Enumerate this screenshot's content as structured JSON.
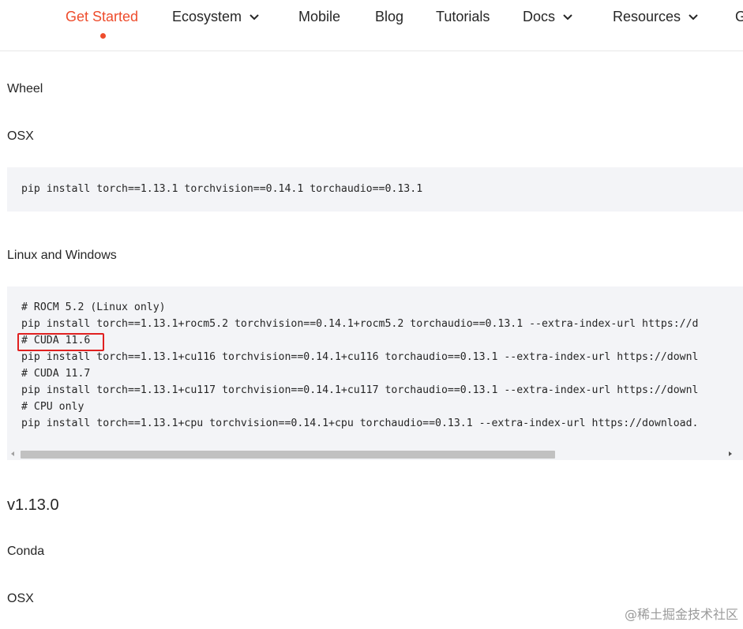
{
  "nav": {
    "items": [
      {
        "label": "Get Started",
        "active": true,
        "dropdown": false
      },
      {
        "label": "Ecosystem",
        "dropdown": true
      },
      {
        "label": "Mobile",
        "dropdown": false
      },
      {
        "label": "Blog",
        "dropdown": false
      },
      {
        "label": "Tutorials",
        "dropdown": false
      },
      {
        "label": "Docs",
        "dropdown": true
      },
      {
        "label": "Resources",
        "dropdown": true
      },
      {
        "label": "G",
        "dropdown": false
      }
    ],
    "active_color": "#ee4c2c"
  },
  "content": {
    "wheel_heading": "Wheel",
    "osx_heading": "OSX",
    "osx_command": "pip install torch==1.13.1 torchvision==0.14.1 torchaudio==0.13.1",
    "linux_windows_heading": "Linux and Windows",
    "linux_lines": [
      "# ROCM 5.2 (Linux only)",
      "pip install torch==1.13.1+rocm5.2 torchvision==0.14.1+rocm5.2 torchaudio==0.13.1 --extra-index-url https://d",
      "# CUDA 11.6",
      "pip install torch==1.13.1+cu116 torchvision==0.14.1+cu116 torchaudio==0.13.1 --extra-index-url https://downl",
      "# CUDA 11.7",
      "pip install torch==1.13.1+cu117 torchvision==0.14.1+cu117 torchaudio==0.13.1 --extra-index-url https://downl",
      "# CPU only",
      "pip install torch==1.13.1+cpu torchvision==0.14.1+cpu torchaudio==0.13.1 --extra-index-url https://download."
    ],
    "highlighted_line": "# CUDA 11.6",
    "highlight_color": "#e02020",
    "version_heading": "v1.13.0",
    "conda_heading": "Conda",
    "osx_heading_2": "OSX"
  },
  "watermark": "@稀土掘金技术社区"
}
